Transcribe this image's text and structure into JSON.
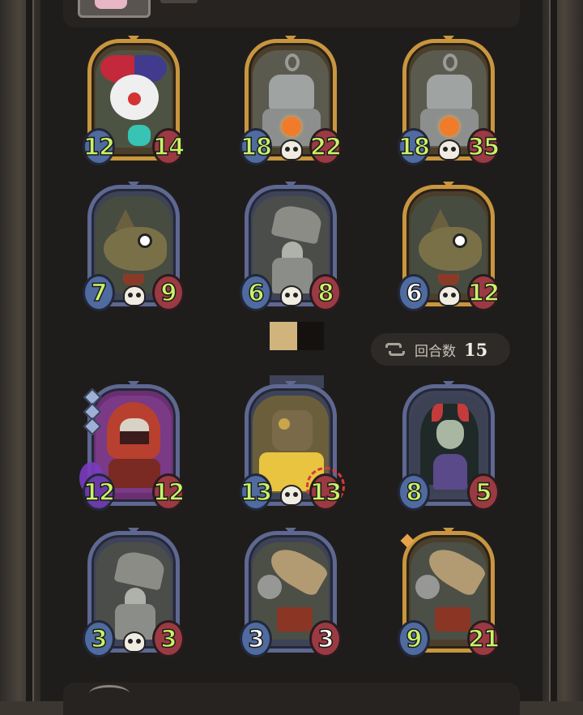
{
  "turn_counter": {
    "label": "回合数",
    "value": "15"
  },
  "cards": [
    {
      "id": "clown",
      "frame": "gold",
      "art": "clown",
      "attack": "12",
      "health": "14",
      "skull": false
    },
    {
      "id": "robot-1",
      "frame": "gold",
      "art": "robot",
      "attack": "18",
      "health": "22",
      "skull": true
    },
    {
      "id": "robot-2",
      "frame": "gold",
      "art": "robot",
      "attack": "18",
      "health": "35",
      "skull": true
    },
    {
      "id": "fish-1",
      "frame": "blue",
      "art": "fish",
      "attack": "7",
      "health": "9",
      "skull": true
    },
    {
      "id": "bell-1",
      "frame": "blue",
      "art": "bell",
      "attack": "6",
      "health": "8",
      "skull": true
    },
    {
      "id": "fish-2",
      "frame": "gold",
      "art": "fish",
      "attack": "6",
      "health": "12",
      "skull": true
    },
    {
      "id": "ninja",
      "frame": "purple",
      "art": "ninja",
      "attack": "12",
      "health": "12",
      "skull": false
    },
    {
      "id": "gold-robot",
      "frame": "blue",
      "art": "gold-robot",
      "attack": "13",
      "health": "13",
      "skull": true
    },
    {
      "id": "elf",
      "frame": "blue",
      "art": "elf",
      "attack": "8",
      "health": "5",
      "skull": false
    },
    {
      "id": "bell-2",
      "frame": "blue",
      "art": "bell",
      "attack": "3",
      "health": "3",
      "skull": true
    },
    {
      "id": "missile-1",
      "frame": "blue",
      "art": "missile",
      "attack": "3",
      "health": "3",
      "skull": false
    },
    {
      "id": "missile-2",
      "frame": "gold",
      "art": "missile",
      "attack": "9",
      "health": "21",
      "skull": false
    }
  ],
  "colors": {
    "attack": "#4f6ba0",
    "health": "#9b3a43",
    "stat_text": "#c9f26b",
    "gold_frame": "#c9963f",
    "blue_frame": "#5e6890"
  }
}
